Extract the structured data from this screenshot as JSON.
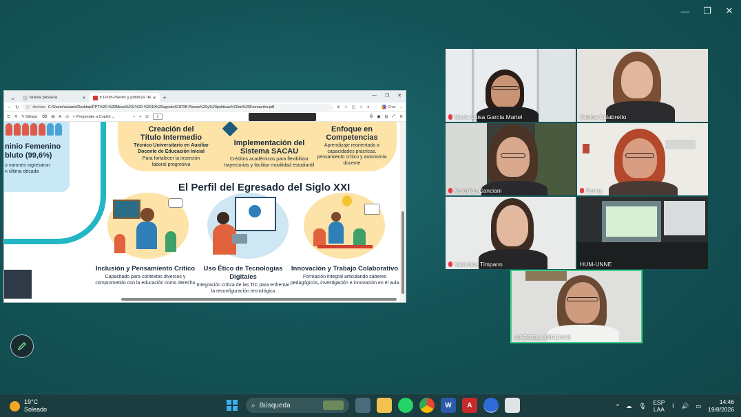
{
  "window": {
    "minimize": "—",
    "restore": "❐",
    "close": "✕"
  },
  "browser": {
    "tabs": [
      {
        "label": "Nueva pestaña",
        "close": "✕"
      },
      {
        "label": "E1P08-Planes y políticas de Forma",
        "close": "✕"
      }
    ],
    "new_tab": "+",
    "address": {
      "file_label": "Archivo",
      "url": "C:/Users/usuario/Desktop/PPT%20-%20Mesa%201%20-%2019%20agosto/E1P08-Planes%20y%20politicas%20de%20Formación.pdf",
      "chat": "Chat"
    },
    "pdf_toolbar": {
      "draw": "Dibujar",
      "ask_copilot": "Pregúntale a Copilot",
      "page": "1",
      "zoom_minus": "−",
      "zoom_plus": "+"
    }
  },
  "pdf": {
    "left_card": {
      "title": "ninio Femenino\nbluto (99,6%)",
      "sub": "o varones ingresaron\nn última década"
    },
    "top_cards": [
      {
        "title": "Creación del\nTítulo Intermedio",
        "sub": "Técnico Universitario en Auxiliar\nDocente de Educación Inicial",
        "sub2": "Para fortalecer la inserción\nlaboral progresiva"
      },
      {
        "title": "Implementación del\nSistema SACAU",
        "sub": "Créditos académicos para flexibilizar\ntrayectorias y facilitar movilidad estudiantil"
      },
      {
        "title": "Enfoque en\nCompetencias",
        "sub": "Aprendizaje reorientado a\ncapacidades prácticas,\npensamiento crítico y autonomía\ndocente"
      }
    ],
    "profile_title": "El Perfil del Egresado del Siglo XXI",
    "profile_items": [
      {
        "title": "Inclusión y Pensamiento Crítico",
        "sub": "Capacitado para contextos diversos y\ncomprometido con la educación como derecho"
      },
      {
        "title": "Uso Ético de Tecnologías Digitales",
        "sub": "Integración crítica de las TIC para enfrentar\nla reconfiguración tecnológica"
      },
      {
        "title": "Innovación y Trabajo Colaborativo",
        "sub": "Formación integral articulando saberes\npedagógicos, investigación e innovación en el aula"
      }
    ]
  },
  "participants": [
    {
      "name": "María Luisa García Martel",
      "muted": true
    },
    {
      "name": "Vanina Calabretto",
      "muted": false
    },
    {
      "name": "Verónica Canciani",
      "muted": true
    },
    {
      "name": "Fanny",
      "muted": true
    },
    {
      "name": "Valentina Timpano",
      "muted": true
    },
    {
      "name": "HUM-UNNE",
      "muted": false
    },
    {
      "name": "MARCELA MIRCHAK",
      "muted": false
    }
  ],
  "taskbar": {
    "weather": {
      "temp": "19°C",
      "condition": "Soleado"
    },
    "search_placeholder": "Búsqueda",
    "lang": {
      "line1": "ESP",
      "line2": "LAA"
    },
    "clock": {
      "time": "14:46",
      "date": "19/8/2026"
    },
    "chevron": "^"
  },
  "colors": {
    "active_speaker_border": "#3fd08a",
    "muted_mic": "#e63946",
    "accent_teal": "#23b6c4"
  }
}
